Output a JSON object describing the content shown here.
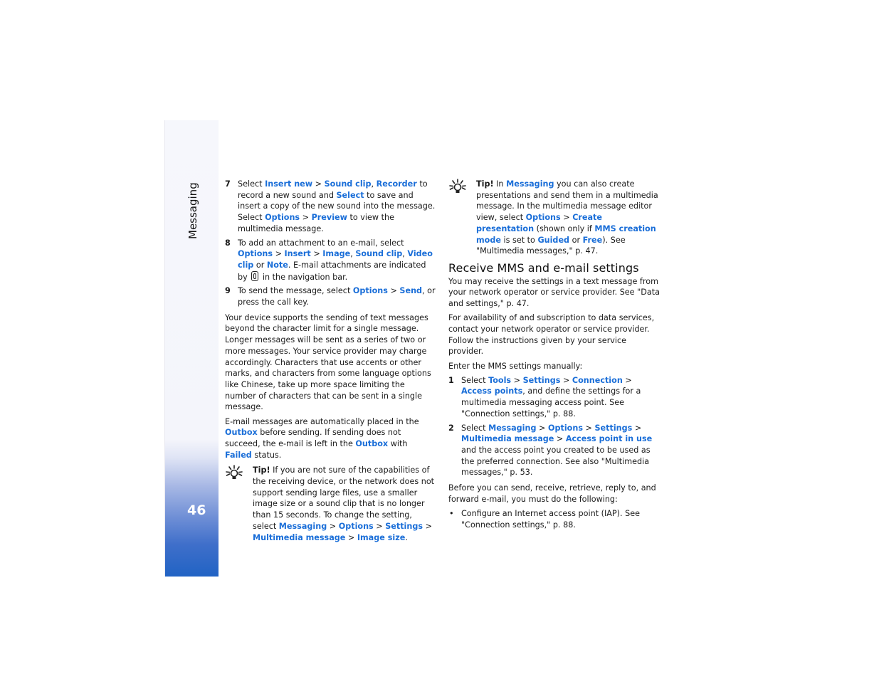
{
  "sidebar": {
    "section_title": "Messaging",
    "page_number": "46",
    "colors": {
      "top": "#f5f6fb",
      "bottom": "#2163c4"
    }
  },
  "link_color": "#1a6ed8",
  "left_column": {
    "steps": [
      {
        "number": "7",
        "parts": [
          {
            "t": "Select "
          },
          {
            "l": "Insert new"
          },
          {
            "t": " > "
          },
          {
            "l": "Sound clip"
          },
          {
            "t": ", "
          },
          {
            "l": "Recorder"
          },
          {
            "t": " to record a new sound and "
          },
          {
            "l": "Select"
          },
          {
            "t": " to save and insert a copy of the new sound into the message. Select "
          },
          {
            "l": "Options"
          },
          {
            "t": " > "
          },
          {
            "l": "Preview"
          },
          {
            "t": " to view the multimedia message."
          }
        ]
      },
      {
        "number": "8",
        "parts": [
          {
            "t": "To add an attachment to an e-mail, select "
          },
          {
            "l": "Options"
          },
          {
            "t": " > "
          },
          {
            "l": "Insert"
          },
          {
            "t": " > "
          },
          {
            "l": "Image"
          },
          {
            "t": ", "
          },
          {
            "l": "Sound clip"
          },
          {
            "t": ", "
          },
          {
            "l": "Video clip"
          },
          {
            "t": " or "
          },
          {
            "l": "Note"
          },
          {
            "t": ". E-mail attachments are indicated by "
          },
          {
            "i": "attachment-clip"
          },
          {
            "t": " in the navigation bar."
          }
        ]
      },
      {
        "number": "9",
        "parts": [
          {
            "t": "To send the message, select "
          },
          {
            "l": "Options"
          },
          {
            "t": " > "
          },
          {
            "l": "Send"
          },
          {
            "t": ", or press the call key."
          }
        ]
      }
    ],
    "paragraph_1": "Your device supports the sending of text messages beyond the character limit for a single message. Longer messages will be sent as a series of two or more messages. Your service provider may charge accordingly. Characters that use accents or other marks, and characters from some language options like Chinese, take up more space limiting the number of characters that can be sent in a single message.",
    "paragraph_2": [
      {
        "t": "E-mail messages are automatically placed in the "
      },
      {
        "l": "Outbox"
      },
      {
        "t": " before sending. If sending does not succeed, the e-mail is left in the "
      },
      {
        "l": "Outbox"
      },
      {
        "t": " with "
      },
      {
        "l": "Failed"
      },
      {
        "t": " status."
      }
    ],
    "tip": [
      {
        "b": "Tip!"
      },
      {
        "t": " If you are not sure of the capabilities of the receiving device, or the network does not support sending large files, use a smaller image size or a sound clip that is no longer than 15 seconds. To change the setting, select "
      },
      {
        "l": "Messaging"
      },
      {
        "t": " > "
      },
      {
        "l": "Options"
      },
      {
        "t": " > "
      },
      {
        "l": "Settings"
      },
      {
        "t": " > "
      },
      {
        "l": "Multimedia message"
      },
      {
        "t": " > "
      },
      {
        "l": "Image size"
      },
      {
        "t": "."
      }
    ]
  },
  "right_column": {
    "tip": [
      {
        "b": "Tip!"
      },
      {
        "t": " In "
      },
      {
        "l": "Messaging"
      },
      {
        "t": " you can also create presentations and send them in a multimedia message. In the multimedia message editor view, select "
      },
      {
        "l": "Options"
      },
      {
        "t": " > "
      },
      {
        "l": "Create presentation"
      },
      {
        "t": " (shown only if "
      },
      {
        "l": "MMS creation mode"
      },
      {
        "t": " is set to "
      },
      {
        "l": "Guided"
      },
      {
        "t": " or "
      },
      {
        "l": "Free"
      },
      {
        "t": "). See \"Multimedia messages,\" p. 47."
      }
    ],
    "heading": "Receive MMS and e-mail settings",
    "paragraph_1": "You may receive the settings in a text message from your network operator or service provider. See \"Data and settings,\" p. 47.",
    "paragraph_2": "For availability of and subscription to data services, contact your network operator or service provider. Follow the instructions given by your service provider.",
    "paragraph_3": "Enter the MMS settings manually:",
    "steps": [
      {
        "number": "1",
        "parts": [
          {
            "t": "Select "
          },
          {
            "l": "Tools"
          },
          {
            "t": " > "
          },
          {
            "l": "Settings"
          },
          {
            "t": " > "
          },
          {
            "l": "Connection"
          },
          {
            "t": " > "
          },
          {
            "l": "Access points"
          },
          {
            "t": ", and define the settings for a multimedia messaging access point. See \"Connection settings,\" p. 88."
          }
        ]
      },
      {
        "number": "2",
        "parts": [
          {
            "t": "Select "
          },
          {
            "l": "Messaging"
          },
          {
            "t": " > "
          },
          {
            "l": "Options"
          },
          {
            "t": " > "
          },
          {
            "l": "Settings"
          },
          {
            "t": " > "
          },
          {
            "l": "Multimedia message"
          },
          {
            "t": " > "
          },
          {
            "l": "Access point in use"
          },
          {
            "t": " and the access point you created to be used as the preferred connection. See also \"Multimedia messages,\" p. 53."
          }
        ]
      }
    ],
    "paragraph_4": "Before you can send, receive, retrieve, reply to, and forward e-mail, you must do the following:",
    "bullets": [
      "Configure an Internet access point (IAP). See \"Connection settings,\" p. 88."
    ]
  }
}
